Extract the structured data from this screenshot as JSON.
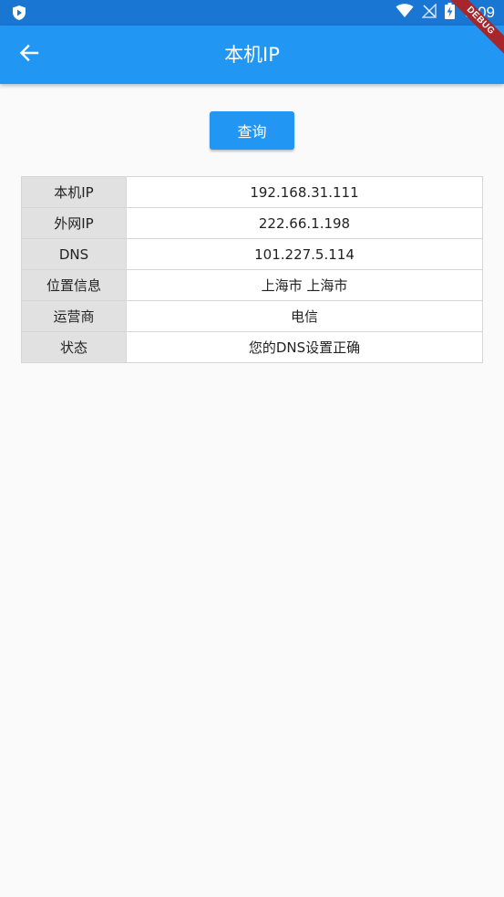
{
  "status_bar": {
    "time": "3:09"
  },
  "app_bar": {
    "title": "本机IP",
    "debug_label": "DEBUG"
  },
  "query_button": {
    "label": "查询"
  },
  "info_table": {
    "rows": [
      {
        "label": "本机IP",
        "value": "192.168.31.111"
      },
      {
        "label": "外网IP",
        "value": "222.66.1.198"
      },
      {
        "label": "DNS",
        "value": "101.227.5.114"
      },
      {
        "label": "位置信息",
        "value": "上海市 上海市"
      },
      {
        "label": "运营商",
        "value": "电信"
      },
      {
        "label": "状态",
        "value": "您的DNS设置正确"
      }
    ]
  },
  "colors": {
    "status_bar": "#1976d2",
    "app_bar": "#2196f3",
    "button": "#2196f3",
    "label_cell": "#e1e1e1",
    "background": "#fafafa",
    "debug_ribbon": "#a6262b"
  },
  "icons": {
    "status_left": "shield-app-icon",
    "wifi": "wifi-icon",
    "signal": "no-signal-icon",
    "battery": "battery-charging-icon",
    "back": "arrow-back-icon"
  }
}
